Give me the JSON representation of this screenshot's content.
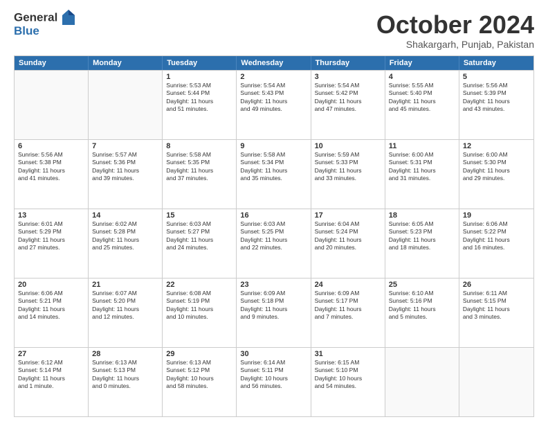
{
  "logo": {
    "line1": "General",
    "line2": "Blue"
  },
  "title": "October 2024",
  "subtitle": "Shakargarh, Punjab, Pakistan",
  "header_days": [
    "Sunday",
    "Monday",
    "Tuesday",
    "Wednesday",
    "Thursday",
    "Friday",
    "Saturday"
  ],
  "weeks": [
    [
      {
        "day": "",
        "info": ""
      },
      {
        "day": "",
        "info": ""
      },
      {
        "day": "1",
        "info": "Sunrise: 5:53 AM\nSunset: 5:44 PM\nDaylight: 11 hours\nand 51 minutes."
      },
      {
        "day": "2",
        "info": "Sunrise: 5:54 AM\nSunset: 5:43 PM\nDaylight: 11 hours\nand 49 minutes."
      },
      {
        "day": "3",
        "info": "Sunrise: 5:54 AM\nSunset: 5:42 PM\nDaylight: 11 hours\nand 47 minutes."
      },
      {
        "day": "4",
        "info": "Sunrise: 5:55 AM\nSunset: 5:40 PM\nDaylight: 11 hours\nand 45 minutes."
      },
      {
        "day": "5",
        "info": "Sunrise: 5:56 AM\nSunset: 5:39 PM\nDaylight: 11 hours\nand 43 minutes."
      }
    ],
    [
      {
        "day": "6",
        "info": "Sunrise: 5:56 AM\nSunset: 5:38 PM\nDaylight: 11 hours\nand 41 minutes."
      },
      {
        "day": "7",
        "info": "Sunrise: 5:57 AM\nSunset: 5:36 PM\nDaylight: 11 hours\nand 39 minutes."
      },
      {
        "day": "8",
        "info": "Sunrise: 5:58 AM\nSunset: 5:35 PM\nDaylight: 11 hours\nand 37 minutes."
      },
      {
        "day": "9",
        "info": "Sunrise: 5:58 AM\nSunset: 5:34 PM\nDaylight: 11 hours\nand 35 minutes."
      },
      {
        "day": "10",
        "info": "Sunrise: 5:59 AM\nSunset: 5:33 PM\nDaylight: 11 hours\nand 33 minutes."
      },
      {
        "day": "11",
        "info": "Sunrise: 6:00 AM\nSunset: 5:31 PM\nDaylight: 11 hours\nand 31 minutes."
      },
      {
        "day": "12",
        "info": "Sunrise: 6:00 AM\nSunset: 5:30 PM\nDaylight: 11 hours\nand 29 minutes."
      }
    ],
    [
      {
        "day": "13",
        "info": "Sunrise: 6:01 AM\nSunset: 5:29 PM\nDaylight: 11 hours\nand 27 minutes."
      },
      {
        "day": "14",
        "info": "Sunrise: 6:02 AM\nSunset: 5:28 PM\nDaylight: 11 hours\nand 25 minutes."
      },
      {
        "day": "15",
        "info": "Sunrise: 6:03 AM\nSunset: 5:27 PM\nDaylight: 11 hours\nand 24 minutes."
      },
      {
        "day": "16",
        "info": "Sunrise: 6:03 AM\nSunset: 5:25 PM\nDaylight: 11 hours\nand 22 minutes."
      },
      {
        "day": "17",
        "info": "Sunrise: 6:04 AM\nSunset: 5:24 PM\nDaylight: 11 hours\nand 20 minutes."
      },
      {
        "day": "18",
        "info": "Sunrise: 6:05 AM\nSunset: 5:23 PM\nDaylight: 11 hours\nand 18 minutes."
      },
      {
        "day": "19",
        "info": "Sunrise: 6:06 AM\nSunset: 5:22 PM\nDaylight: 11 hours\nand 16 minutes."
      }
    ],
    [
      {
        "day": "20",
        "info": "Sunrise: 6:06 AM\nSunset: 5:21 PM\nDaylight: 11 hours\nand 14 minutes."
      },
      {
        "day": "21",
        "info": "Sunrise: 6:07 AM\nSunset: 5:20 PM\nDaylight: 11 hours\nand 12 minutes."
      },
      {
        "day": "22",
        "info": "Sunrise: 6:08 AM\nSunset: 5:19 PM\nDaylight: 11 hours\nand 10 minutes."
      },
      {
        "day": "23",
        "info": "Sunrise: 6:09 AM\nSunset: 5:18 PM\nDaylight: 11 hours\nand 9 minutes."
      },
      {
        "day": "24",
        "info": "Sunrise: 6:09 AM\nSunset: 5:17 PM\nDaylight: 11 hours\nand 7 minutes."
      },
      {
        "day": "25",
        "info": "Sunrise: 6:10 AM\nSunset: 5:16 PM\nDaylight: 11 hours\nand 5 minutes."
      },
      {
        "day": "26",
        "info": "Sunrise: 6:11 AM\nSunset: 5:15 PM\nDaylight: 11 hours\nand 3 minutes."
      }
    ],
    [
      {
        "day": "27",
        "info": "Sunrise: 6:12 AM\nSunset: 5:14 PM\nDaylight: 11 hours\nand 1 minute."
      },
      {
        "day": "28",
        "info": "Sunrise: 6:13 AM\nSunset: 5:13 PM\nDaylight: 11 hours\nand 0 minutes."
      },
      {
        "day": "29",
        "info": "Sunrise: 6:13 AM\nSunset: 5:12 PM\nDaylight: 10 hours\nand 58 minutes."
      },
      {
        "day": "30",
        "info": "Sunrise: 6:14 AM\nSunset: 5:11 PM\nDaylight: 10 hours\nand 56 minutes."
      },
      {
        "day": "31",
        "info": "Sunrise: 6:15 AM\nSunset: 5:10 PM\nDaylight: 10 hours\nand 54 minutes."
      },
      {
        "day": "",
        "info": ""
      },
      {
        "day": "",
        "info": ""
      }
    ]
  ]
}
